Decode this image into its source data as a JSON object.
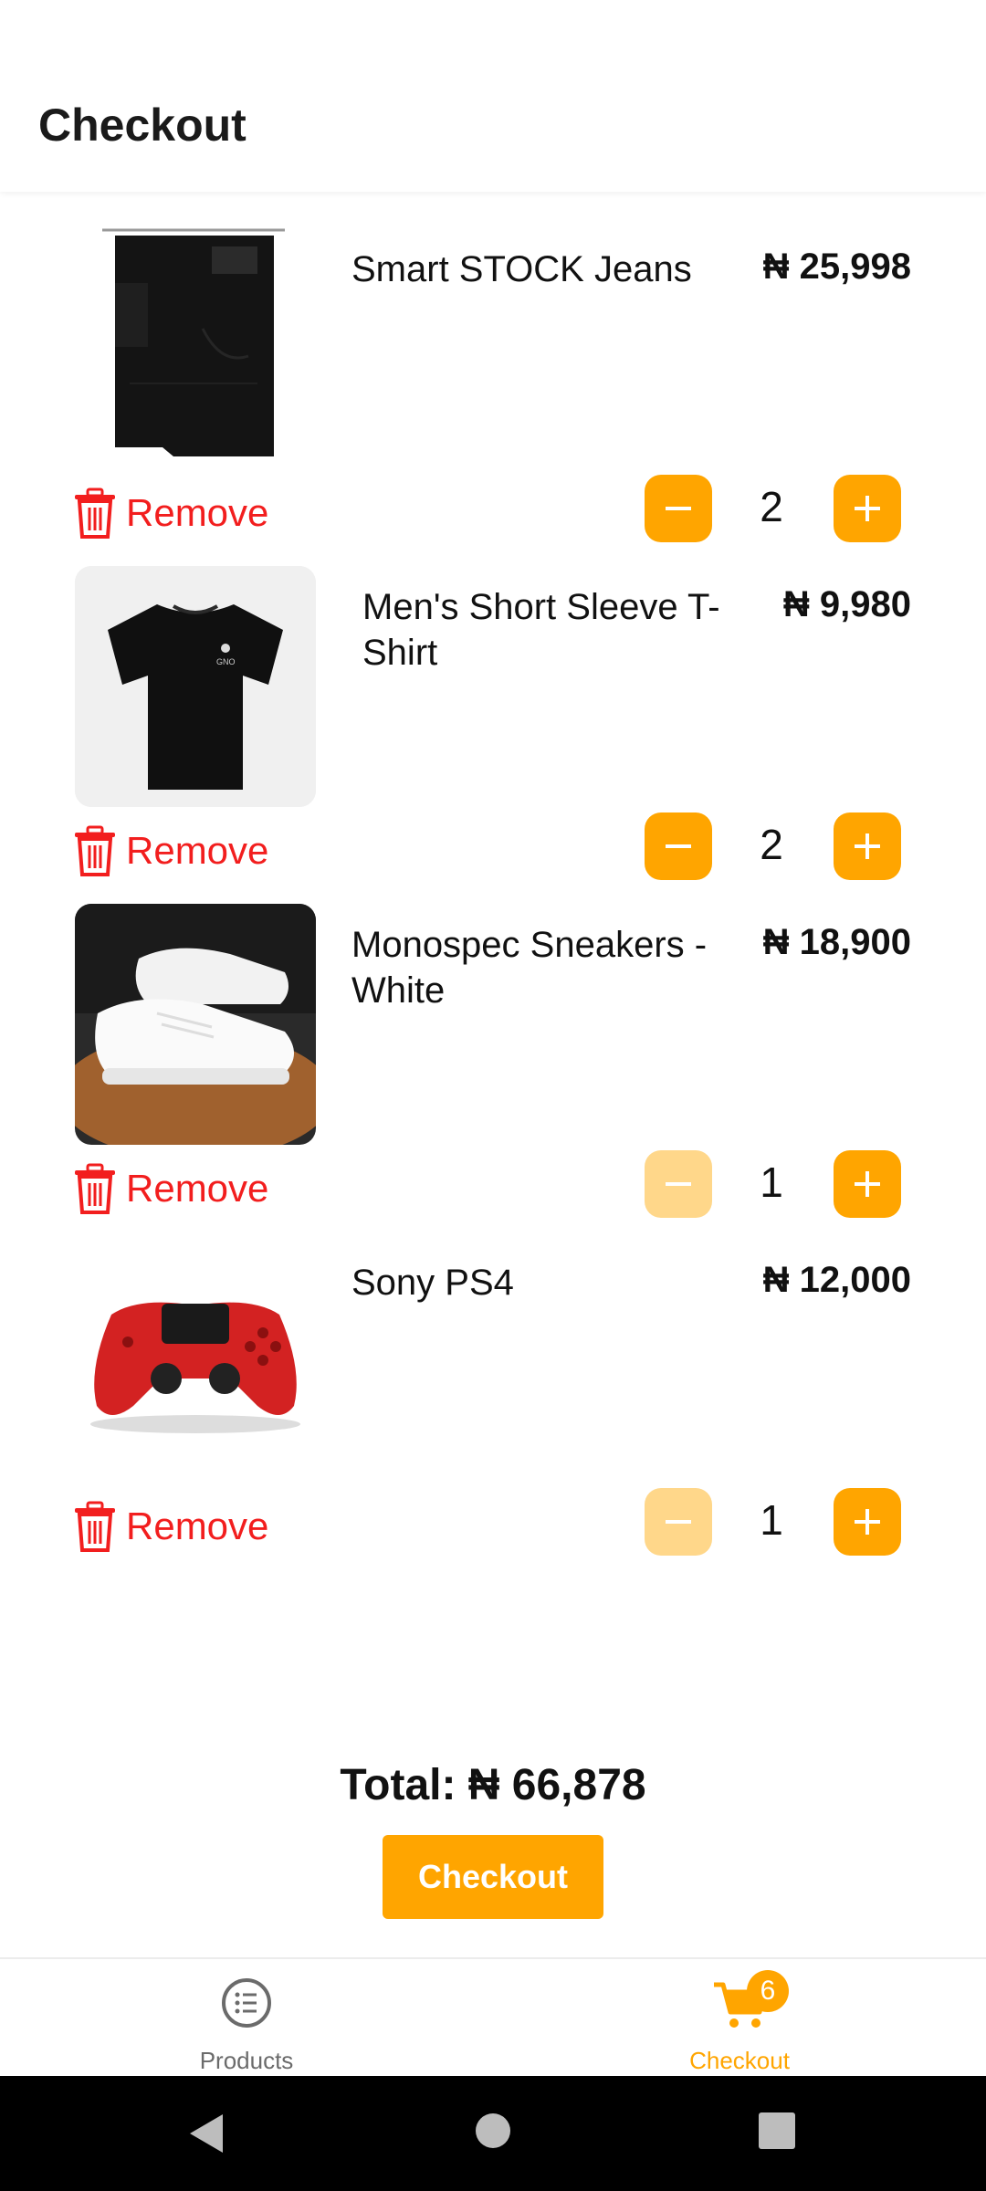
{
  "header": {
    "title": "Checkout"
  },
  "items": [
    {
      "name": "Smart STOCK Jeans",
      "price": "₦ 25,998",
      "quantity": "2",
      "remove_label": "Remove",
      "minus_enabled": true,
      "image": "black-jeans"
    },
    {
      "name": "Men's Short Sleeve T-Shirt",
      "price": "₦ 9,980",
      "quantity": "2",
      "remove_label": "Remove",
      "minus_enabled": true,
      "image": "black-tshirt"
    },
    {
      "name": "Monospec Sneakers - White",
      "price": "₦ 18,900",
      "quantity": "1",
      "remove_label": "Remove",
      "minus_enabled": false,
      "image": "white-sneakers"
    },
    {
      "name": "Sony PS4",
      "price": "₦ 12,000",
      "quantity": "1",
      "remove_label": "Remove",
      "minus_enabled": false,
      "image": "red-ps4-controller"
    }
  ],
  "summary": {
    "total": "Total: ₦  66,878",
    "checkout_label": "Checkout"
  },
  "bottom_nav": {
    "tabs": [
      {
        "label": "Products",
        "icon": "list-icon",
        "active": false
      },
      {
        "label": "Checkout",
        "icon": "cart-icon",
        "active": true,
        "badge": "6"
      }
    ]
  },
  "colors": {
    "accent": "#ffa500",
    "accent_disabled": "#ffd78a",
    "danger": "#f21e1e"
  }
}
